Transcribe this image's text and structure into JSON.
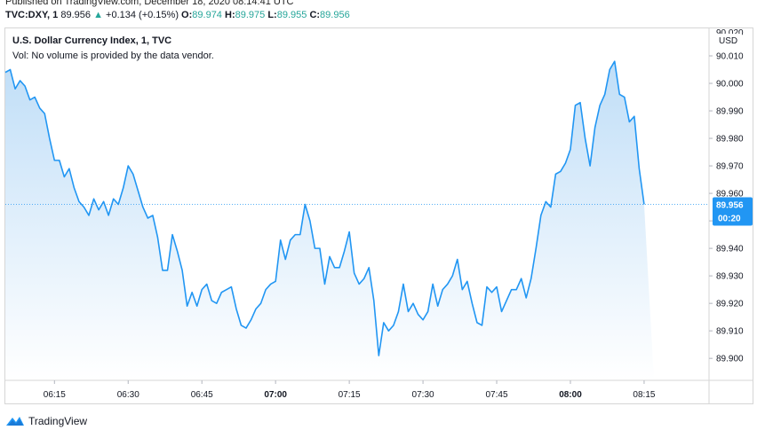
{
  "header": {
    "published": "Published on TradingView.com, December 18, 2020 08:14:41 UTC",
    "symbol": "TVC:DXY, 1",
    "last": "89.956",
    "change": "+0.134 (+0.15%)",
    "open_label": "O:",
    "open": "89.974",
    "high_label": "H:",
    "high": "89.975",
    "low_label": "L:",
    "low": "89.955",
    "close_label": "C:",
    "close": "89.956"
  },
  "legend": {
    "title": "U.S. Dollar Currency Index, 1, TVC",
    "volume_note": "Vol: No volume is provided by the data vendor."
  },
  "price_axis": {
    "currency": "USD",
    "last_price_tag": "89.956",
    "countdown_tag": "00:20"
  },
  "footer": {
    "brand": "TradingView"
  },
  "colors": {
    "line": "#2196f3",
    "fill_top": "#bcdcf7",
    "fill_bottom": "#ffffff",
    "tag_bg": "#2196f3"
  },
  "chart_data": {
    "type": "area",
    "title": "U.S. Dollar Currency Index, 1, TVC",
    "xlabel": "",
    "ylabel": "",
    "ylim": [
      89.892,
      90.02
    ],
    "y_ticks": [
      89.9,
      89.91,
      89.92,
      89.93,
      89.94,
      89.95,
      89.96,
      89.97,
      89.98,
      89.99,
      90.0,
      90.01,
      90.02
    ],
    "y_tick_labels": [
      "89.900",
      "89.910",
      "89.920",
      "89.930",
      "89.940",
      "89.950",
      "89.960",
      "89.970",
      "89.980",
      "89.990",
      "90.000",
      "90.010",
      "90.020"
    ],
    "x_ticks": [
      "06:15",
      "06:30",
      "06:45",
      "07:00",
      "07:15",
      "07:30",
      "07:45",
      "08:00",
      "08:15"
    ],
    "x_tick_bold": [
      "07:00",
      "08:00"
    ],
    "x_start": "06:05",
    "x_range_minutes": [
      0,
      132
    ],
    "minutes": [
      0,
      1,
      2,
      3,
      4,
      5,
      6,
      7,
      8,
      9,
      10,
      11,
      12,
      13,
      14,
      15,
      16,
      17,
      18,
      19,
      20,
      21,
      22,
      23,
      24,
      25,
      26,
      27,
      28,
      29,
      30,
      31,
      32,
      33,
      34,
      35,
      36,
      37,
      38,
      39,
      40,
      41,
      42,
      43,
      44,
      45,
      46,
      47,
      48,
      49,
      50,
      51,
      52,
      53,
      54,
      55,
      56,
      57,
      58,
      59,
      60,
      61,
      62,
      63,
      64,
      65,
      66,
      67,
      68,
      69,
      70,
      71,
      72,
      73,
      74,
      75,
      76,
      77,
      78,
      79,
      80,
      81,
      82,
      83,
      84,
      85,
      86,
      87,
      88,
      89,
      90,
      91,
      92,
      93,
      94,
      95,
      96,
      97,
      98,
      99,
      100,
      101,
      102,
      103,
      104,
      105,
      106,
      107,
      108,
      109,
      110,
      111,
      112,
      113,
      114,
      115,
      116,
      117,
      118,
      119,
      120,
      121,
      122,
      123,
      124,
      125,
      126,
      127,
      128,
      129,
      130,
      131,
      132
    ],
    "values": [
      90.004,
      90.005,
      89.998,
      90.001,
      89.999,
      89.994,
      89.995,
      89.991,
      89.989,
      89.98,
      89.972,
      89.972,
      89.966,
      89.969,
      89.962,
      89.957,
      89.955,
      89.952,
      89.958,
      89.954,
      89.957,
      89.952,
      89.958,
      89.956,
      89.962,
      89.97,
      89.967,
      89.961,
      89.955,
      89.951,
      89.952,
      89.944,
      89.932,
      89.932,
      89.945,
      89.939,
      89.932,
      89.919,
      89.924,
      89.919,
      89.925,
      89.927,
      89.921,
      89.92,
      89.924,
      89.925,
      89.926,
      89.918,
      89.912,
      89.911,
      89.914,
      89.918,
      89.92,
      89.925,
      89.927,
      89.928,
      89.943,
      89.936,
      89.943,
      89.945,
      89.945,
      89.956,
      89.95,
      89.94,
      89.94,
      89.927,
      89.937,
      89.933,
      89.933,
      89.939,
      89.946,
      89.931,
      89.927,
      89.929,
      89.933,
      89.921,
      89.901,
      89.913,
      89.91,
      89.912,
      89.917,
      89.927,
      89.917,
      89.92,
      89.916,
      89.914,
      89.917,
      89.927,
      89.919,
      89.925,
      89.927,
      89.93,
      89.936,
      89.925,
      89.928,
      89.92,
      89.913,
      89.912,
      89.926,
      89.924,
      89.926,
      89.917,
      89.921,
      89.925,
      89.925,
      89.929,
      89.922,
      89.929,
      89.94,
      89.952,
      89.957,
      89.955,
      89.967,
      89.968,
      89.971,
      89.976,
      89.992,
      89.993,
      89.98,
      89.97,
      89.984,
      89.992,
      89.996,
      90.005,
      90.008,
      89.996,
      89.995,
      89.986,
      89.988,
      89.969,
      89.956
    ]
  }
}
